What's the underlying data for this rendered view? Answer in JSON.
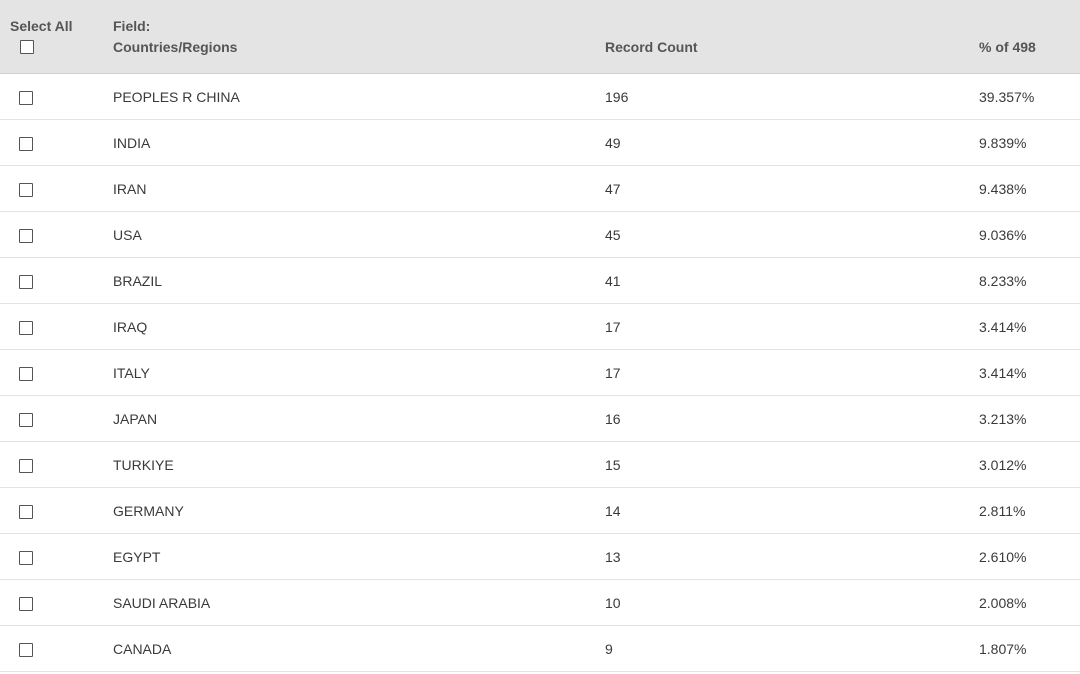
{
  "header": {
    "select_all": "Select All",
    "field_line1": "Field:",
    "field_line2": "Countries/Regions",
    "record_count": "Record Count",
    "percent_of": "% of 498"
  },
  "rows": [
    {
      "name": "PEOPLES R CHINA",
      "count": "196",
      "percent": "39.357%"
    },
    {
      "name": "INDIA",
      "count": "49",
      "percent": "9.839%"
    },
    {
      "name": "IRAN",
      "count": "47",
      "percent": "9.438%"
    },
    {
      "name": "USA",
      "count": "45",
      "percent": "9.036%"
    },
    {
      "name": "BRAZIL",
      "count": "41",
      "percent": "8.233%"
    },
    {
      "name": "IRAQ",
      "count": "17",
      "percent": "3.414%"
    },
    {
      "name": "ITALY",
      "count": "17",
      "percent": "3.414%"
    },
    {
      "name": "JAPAN",
      "count": "16",
      "percent": "3.213%"
    },
    {
      "name": "TURKIYE",
      "count": "15",
      "percent": "3.012%"
    },
    {
      "name": "GERMANY",
      "count": "14",
      "percent": "2.811%"
    },
    {
      "name": "EGYPT",
      "count": "13",
      "percent": "2.610%"
    },
    {
      "name": "SAUDI ARABIA",
      "count": "10",
      "percent": "2.008%"
    },
    {
      "name": "CANADA",
      "count": "9",
      "percent": "1.807%"
    }
  ],
  "colors": {
    "header_bg": "#e4e4e4",
    "row_border": "#e3e3e3",
    "text": "#3a3a3a"
  }
}
